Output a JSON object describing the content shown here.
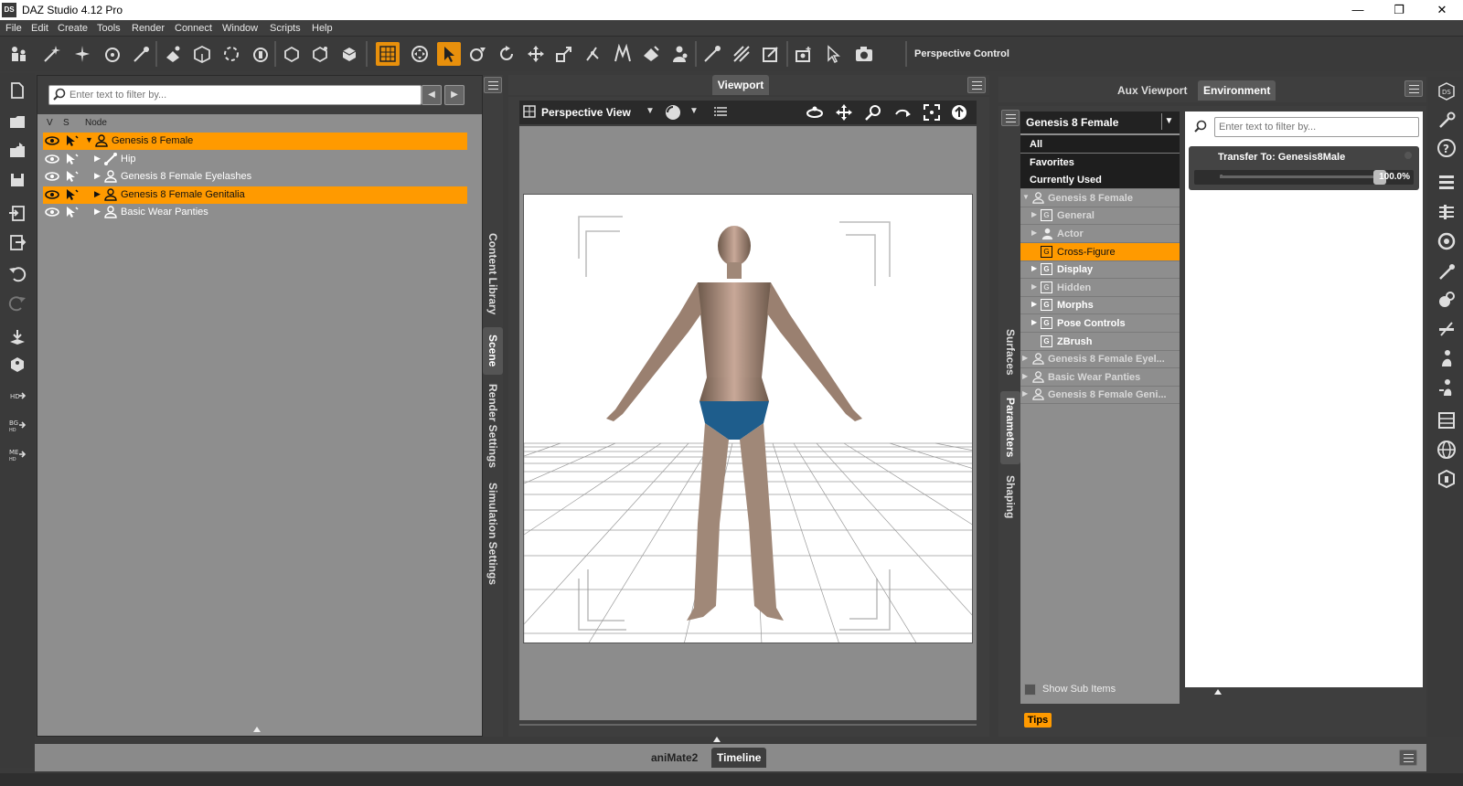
{
  "window": {
    "title": "DAZ Studio 4.12 Pro",
    "app_icon": "DS",
    "minimize": "—",
    "maximize": "❐",
    "close": "✕"
  },
  "menu": [
    "File",
    "Edit",
    "Create",
    "Tools",
    "Render",
    "Connect",
    "Window",
    "Scripts",
    "Help"
  ],
  "toolbar": {
    "context_label": "Perspective Control",
    "active_tool": "node-selection-tool"
  },
  "scene": {
    "filter_placeholder": "Enter text to filter by...",
    "columns": [
      "V",
      "S",
      "Node"
    ],
    "nodes": [
      {
        "label": "Genesis 8 Female",
        "selected": true,
        "expanded": true,
        "indent": 0,
        "icon": "figure-icon"
      },
      {
        "label": "Hip",
        "selected": false,
        "expanded": false,
        "indent": 1,
        "icon": "bone-icon"
      },
      {
        "label": "Genesis 8 Female Eyelashes",
        "selected": false,
        "expanded": false,
        "indent": 1,
        "icon": "figure-icon"
      },
      {
        "label": "Genesis 8 Female Genitalia",
        "selected": true,
        "expanded": false,
        "indent": 1,
        "icon": "figure-icon"
      },
      {
        "label": "Basic Wear Panties",
        "selected": false,
        "expanded": false,
        "indent": 1,
        "icon": "figure-icon"
      }
    ],
    "side_tabs": [
      "Content Library",
      "Scene",
      "Render Settings",
      "Simulation Settings"
    ],
    "active_side_tab": "Scene"
  },
  "viewport": {
    "tab": "Viewport",
    "view_label": "Perspective View"
  },
  "right_panel": {
    "tabs": [
      "Aux Viewport",
      "Environment"
    ],
    "active_tab": "Environment",
    "side_tabs": [
      "Surfaces",
      "Parameters",
      "Shaping"
    ],
    "active_side_tab": "Parameters",
    "figure_select": "Genesis 8 Female",
    "list": [
      {
        "label": "All",
        "style": "dark"
      },
      {
        "label": "Favorites",
        "style": "dark"
      },
      {
        "label": "Currently Used",
        "style": "dark"
      },
      {
        "label": "Genesis 8 Female",
        "style": "muted",
        "arrow": "▼",
        "icon": "figure"
      },
      {
        "label": "General",
        "style": "muted",
        "arrow": "▶",
        "icon": "G"
      },
      {
        "label": "Actor",
        "style": "muted",
        "arrow": "▶",
        "icon": "actor"
      },
      {
        "label": "Cross-Figure",
        "style": "sel",
        "arrow": "",
        "icon": "G"
      },
      {
        "label": "Display",
        "style": "item",
        "arrow": "▶",
        "icon": "G"
      },
      {
        "label": "Hidden",
        "style": "muted",
        "arrow": "▶",
        "icon": "G"
      },
      {
        "label": "Morphs",
        "style": "item",
        "arrow": "▶",
        "icon": "G"
      },
      {
        "label": "Pose Controls",
        "style": "item",
        "arrow": "▶",
        "icon": "G"
      },
      {
        "label": "ZBrush",
        "style": "item",
        "arrow": "",
        "icon": "G"
      },
      {
        "label": "Genesis 8 Female Eyel...",
        "style": "muted",
        "arrow": "▶",
        "icon": "figure"
      },
      {
        "label": "Basic Wear Panties",
        "style": "muted",
        "arrow": "▶",
        "icon": "figure"
      },
      {
        "label": "Genesis 8 Female Geni...",
        "style": "muted",
        "arrow": "▶",
        "icon": "figure"
      }
    ],
    "show_sub_items": "Show Sub Items",
    "tips": "Tips",
    "filter_placeholder": "Enter text to filter by...",
    "parameter": {
      "label": "Transfer To: Genesis8Male",
      "value_text": "100.0%",
      "value": 1.0,
      "minus": "-"
    }
  },
  "bottom": {
    "tabs": [
      "aniMate2",
      "Timeline"
    ],
    "active_tab": "Timeline"
  },
  "colors": {
    "accent": "#ff9a00",
    "panel_bg": "#3e3e3e",
    "list_bg": "#8e8e8e"
  }
}
